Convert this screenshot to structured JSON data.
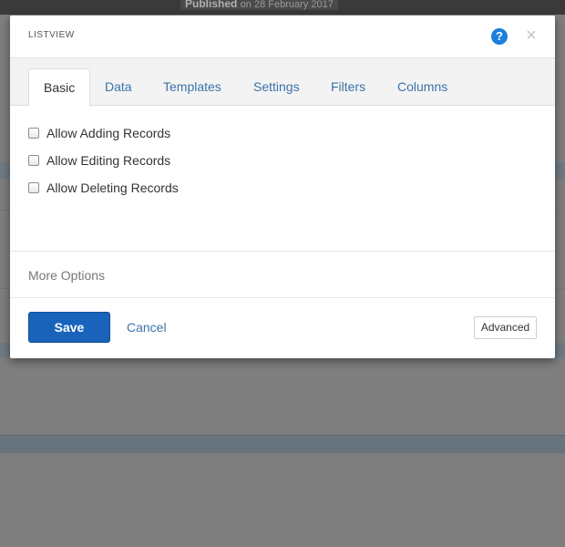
{
  "backdrop": {
    "published_label": "Published",
    "published_date": "on 28 February 2017"
  },
  "modal": {
    "title": "LISTVIEW",
    "help_icon": "question-circle-icon",
    "close_icon": "close-icon",
    "tabs": [
      {
        "label": "Basic",
        "active": true
      },
      {
        "label": "Data",
        "active": false
      },
      {
        "label": "Templates",
        "active": false
      },
      {
        "label": "Settings",
        "active": false
      },
      {
        "label": "Filters",
        "active": false
      },
      {
        "label": "Columns",
        "active": false
      }
    ],
    "options": [
      {
        "label": "Allow Adding Records",
        "checked": false
      },
      {
        "label": "Allow Editing Records",
        "checked": false
      },
      {
        "label": "Allow Deleting Records",
        "checked": false
      }
    ],
    "more_options_label": "More Options",
    "save_label": "Save",
    "cancel_label": "Cancel",
    "advanced_label": "Advanced"
  },
  "colors": {
    "primary": "#1a63bb",
    "link": "#3b73a8",
    "help": "#1c7fdc"
  }
}
